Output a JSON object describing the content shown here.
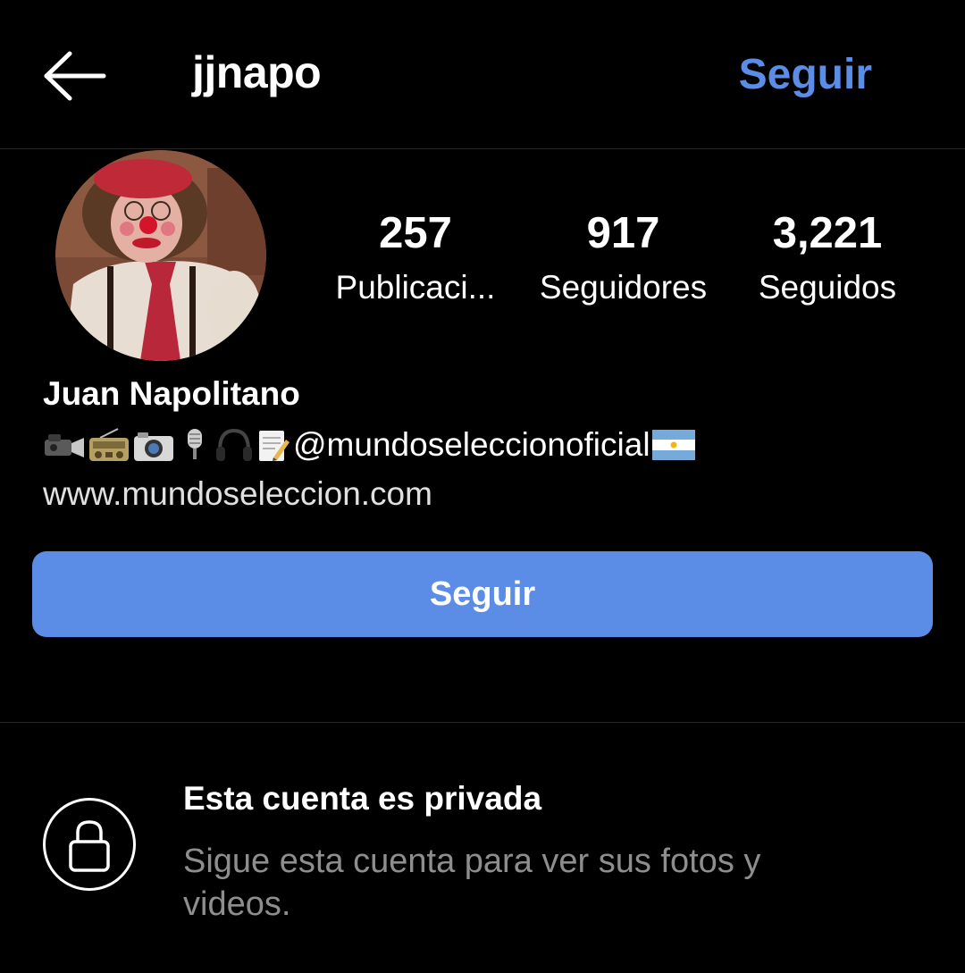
{
  "header": {
    "back_icon": "arrow-left-icon",
    "username": "jjnapo",
    "follow_label": "Seguir"
  },
  "profile": {
    "avatar_icon": "profile-avatar-photo",
    "stats": [
      {
        "value": "257",
        "label": "Publicaci..."
      },
      {
        "value": "917",
        "label": "Seguidores"
      },
      {
        "value": "3,221",
        "label": "Seguidos"
      }
    ],
    "display_name": "Juan Napolitano",
    "bio_emojis": [
      "video-camera-icon",
      "radio-icon",
      "camera-icon",
      "microphone-icon",
      "headphones-icon",
      "memo-icon"
    ],
    "bio_mention": "@mundoseleccionoficial",
    "bio_flag": "argentina-flag-icon",
    "website": "www.mundoseleccion.com",
    "follow_button_label": "Seguir"
  },
  "private_notice": {
    "icon": "lock-icon",
    "title": "Esta cuenta es privada",
    "description": "Sigue esta cuenta para ver sus fotos y videos."
  },
  "colors": {
    "background": "#000000",
    "accent": "#5b8de6",
    "muted_text": "#8e8e8e",
    "divider": "#262626"
  }
}
